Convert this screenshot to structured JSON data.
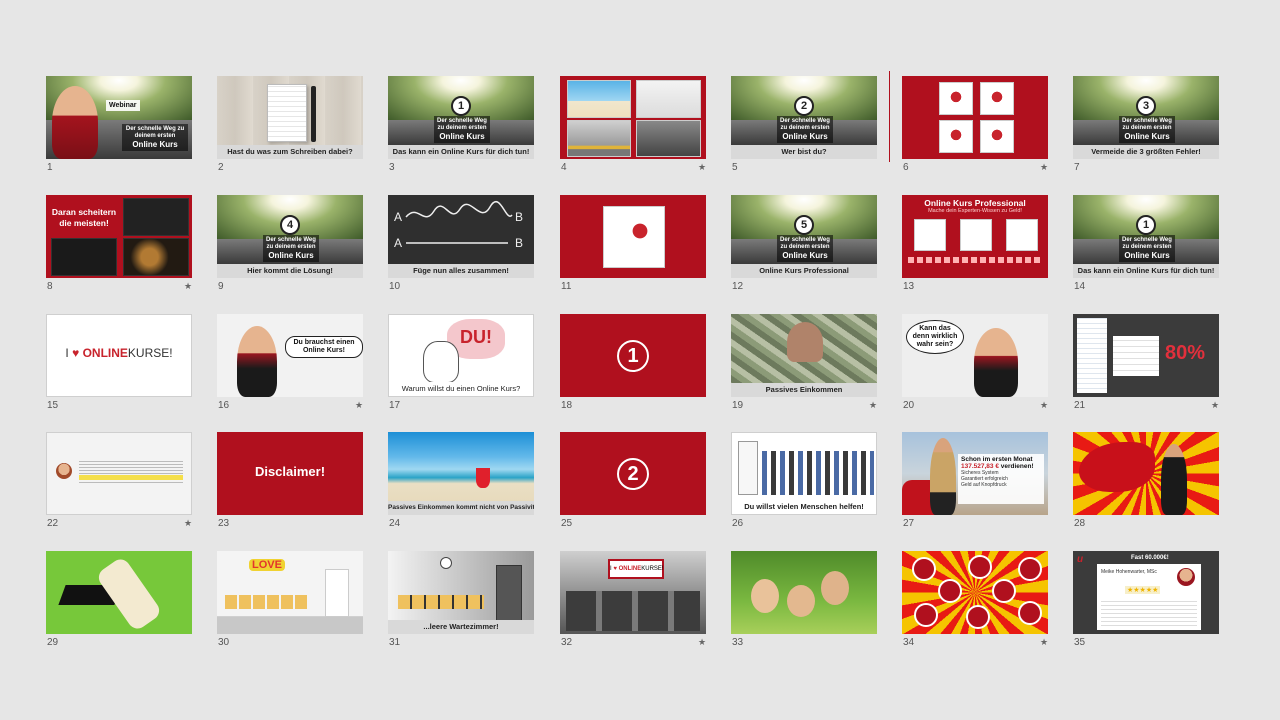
{
  "colors": {
    "accent": "#b0101e",
    "background": "#e6e6e6"
  },
  "slides": [
    {
      "number": "1",
      "label": "Webinar",
      "sub": "Der schnelle Weg zu deinem ersten",
      "title": "Online Kurs"
    },
    {
      "number": "2",
      "caption": "Hast du was zum Schreiben dabei?"
    },
    {
      "number": "3",
      "badge": "1",
      "sub": "Der schnelle Weg zu deinem ersten",
      "title": "Online Kurs",
      "caption": "Das kann ein Online Kurs für dich tun!"
    },
    {
      "number": "4",
      "star": "★"
    },
    {
      "number": "5",
      "badge": "2",
      "sub": "Der schnelle Weg zu deinem ersten",
      "title": "Online Kurs",
      "caption": "Wer bist du?"
    },
    {
      "number": "6",
      "star": "★"
    },
    {
      "number": "7",
      "badge": "3",
      "sub": "Der schnelle Weg zu deinem ersten",
      "title": "Online Kurs",
      "caption": "Vermeide die 3 größten Fehler!"
    },
    {
      "number": "8",
      "star": "★",
      "title": "Daran scheitern die meisten!"
    },
    {
      "number": "9",
      "badge": "4",
      "sub": "Der schnelle Weg zu deinem ersten",
      "title": "Online Kurs",
      "caption": "Hier kommt die Lösung!"
    },
    {
      "number": "10",
      "caption": "Füge nun alles zusammen!",
      "label_a": "A",
      "label_b": "B"
    },
    {
      "number": "11"
    },
    {
      "number": "12",
      "badge": "5",
      "sub": "Der schnelle Weg zu deinem ersten",
      "title": "Online Kurs",
      "caption": "Online Kurs Professional"
    },
    {
      "number": "13",
      "title": "Online Kurs Professional",
      "sub": "Mache dein Experten-Wissen zu Geld!"
    },
    {
      "number": "14",
      "badge": "1",
      "sub": "Der schnelle Weg zu deinem ersten",
      "title": "Online Kurs",
      "caption": "Das kann ein Online Kurs für dich tun!"
    },
    {
      "number": "15",
      "pre": "I",
      "word1": "ONLINE",
      "word2": "KURSE!"
    },
    {
      "number": "16",
      "star": "★",
      "bubble": "Du brauchst einen Online Kurs!"
    },
    {
      "number": "17",
      "word": "DU!",
      "caption": "Warum willst du einen Online Kurs?"
    },
    {
      "number": "18",
      "badge": "1"
    },
    {
      "number": "19",
      "star": "★",
      "caption": "Passives Einkommen"
    },
    {
      "number": "20",
      "star": "★",
      "bubble": "Kann das denn wirklich wahr sein?"
    },
    {
      "number": "21",
      "star": "★",
      "percent": "80%"
    },
    {
      "number": "22",
      "star": "★"
    },
    {
      "number": "23",
      "title": "Disclaimer!"
    },
    {
      "number": "24",
      "caption": "Passives Einkommen kommt nicht von Passivität!"
    },
    {
      "number": "25",
      "badge": "2"
    },
    {
      "number": "26",
      "caption": "Du willst vielen Menschen helfen!"
    },
    {
      "number": "27",
      "title": "Schon im ersten Monat",
      "amount": "137.527,83 €",
      "amount_suffix": "verdienen!",
      "bullets": [
        "Sicheres System",
        "Garantiert erfolgreich",
        "Geld auf Knopfdruck"
      ]
    },
    {
      "number": "28"
    },
    {
      "number": "29"
    },
    {
      "number": "30",
      "word": "LOVE"
    },
    {
      "number": "31",
      "caption": "...leere Wartezimmer!"
    },
    {
      "number": "32",
      "star": "★",
      "pre": "I",
      "word1": "ONLINE",
      "word2": "KURSE!"
    },
    {
      "number": "33"
    },
    {
      "number": "34",
      "star": "★"
    },
    {
      "number": "35",
      "title": "Fast 60.000€!",
      "name": "Meike Hohenwarter, MSc"
    }
  ]
}
